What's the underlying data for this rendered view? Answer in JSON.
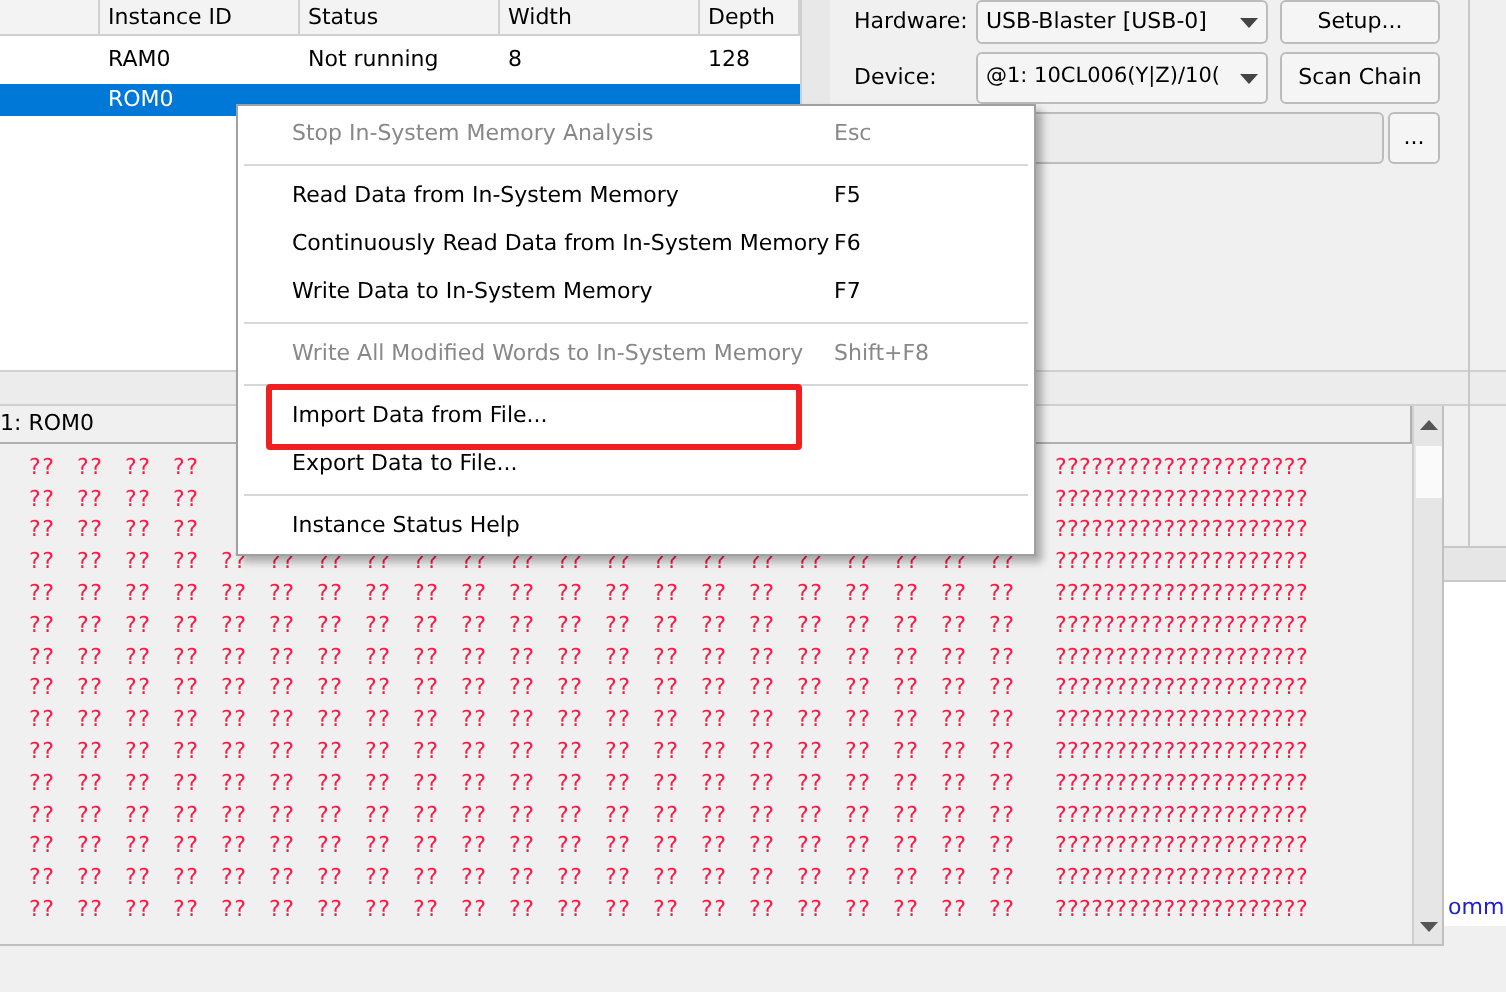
{
  "instances": {
    "columns": [
      "Instance ID",
      "Status",
      "Width",
      "Depth"
    ],
    "rows": [
      {
        "cells": [
          "RAM0",
          "Not running",
          "8",
          "128"
        ],
        "selected": false
      },
      {
        "cells": [
          "ROM0"
        ],
        "selected": true
      }
    ]
  },
  "jtag": {
    "hardware_label": "Hardware:",
    "hardware": "USB-Blaster [USB-0]",
    "setup_button": "Setup...",
    "device_label": "Device:",
    "device": "@1: 10CL006(Y|Z)/10(",
    "scan_button": "Scan Chain",
    "browse_button": "..."
  },
  "memory": {
    "title": "1: ROM0",
    "rows": [
      {
        "cells": [
          "??",
          "??",
          "??",
          "??"
        ],
        "ascii": "?????????????????????"
      },
      {
        "cells": [
          "??",
          "??",
          "??",
          "??"
        ],
        "ascii": "?????????????????????"
      },
      {
        "cells": [
          "??",
          "??",
          "??",
          "??"
        ],
        "ascii": "?????????????????????"
      },
      {
        "cells": [
          "??",
          "??",
          "??",
          "??",
          "??",
          "??",
          "??",
          "??",
          "??",
          "??",
          "??",
          "??",
          "??",
          "??",
          "??",
          "??",
          "??",
          "??",
          "??",
          "??",
          "??"
        ],
        "ascii": "?????????????????????"
      },
      {
        "cells": [
          "??",
          "??",
          "??",
          "??",
          "??",
          "??",
          "??",
          "??",
          "??",
          "??",
          "??",
          "??",
          "??",
          "??",
          "??",
          "??",
          "??",
          "??",
          "??",
          "??",
          "??"
        ],
        "ascii": "?????????????????????"
      },
      {
        "cells": [
          "??",
          "??",
          "??",
          "??",
          "??",
          "??",
          "??",
          "??",
          "??",
          "??",
          "??",
          "??",
          "??",
          "??",
          "??",
          "??",
          "??",
          "??",
          "??",
          "??",
          "??"
        ],
        "ascii": "?????????????????????"
      },
      {
        "cells": [
          "??",
          "??",
          "??",
          "??",
          "??",
          "??",
          "??",
          "??",
          "??",
          "??",
          "??",
          "??",
          "??",
          "??",
          "??",
          "??",
          "??",
          "??",
          "??",
          "??",
          "??"
        ],
        "ascii": "?????????????????????"
      },
      {
        "cells": [
          "??",
          "??",
          "??",
          "??",
          "??",
          "??",
          "??",
          "??",
          "??",
          "??",
          "??",
          "??",
          "??",
          "??",
          "??",
          "??",
          "??",
          "??",
          "??",
          "??",
          "??"
        ],
        "ascii": "?????????????????????"
      },
      {
        "cells": [
          "??",
          "??",
          "??",
          "??",
          "??",
          "??",
          "??",
          "??",
          "??",
          "??",
          "??",
          "??",
          "??",
          "??",
          "??",
          "??",
          "??",
          "??",
          "??",
          "??",
          "??"
        ],
        "ascii": "?????????????????????"
      },
      {
        "cells": [
          "??",
          "??",
          "??",
          "??",
          "??",
          "??",
          "??",
          "??",
          "??",
          "??",
          "??",
          "??",
          "??",
          "??",
          "??",
          "??",
          "??",
          "??",
          "??",
          "??",
          "??"
        ],
        "ascii": "?????????????????????"
      },
      {
        "cells": [
          "??",
          "??",
          "??",
          "??",
          "??",
          "??",
          "??",
          "??",
          "??",
          "??",
          "??",
          "??",
          "??",
          "??",
          "??",
          "??",
          "??",
          "??",
          "??",
          "??",
          "??"
        ],
        "ascii": "?????????????????????"
      },
      {
        "cells": [
          "??",
          "??",
          "??",
          "??",
          "??",
          "??",
          "??",
          "??",
          "??",
          "??",
          "??",
          "??",
          "??",
          "??",
          "??",
          "??",
          "??",
          "??",
          "??",
          "??",
          "??"
        ],
        "ascii": "?????????????????????"
      },
      {
        "cells": [
          "??",
          "??",
          "??",
          "??",
          "??",
          "??",
          "??",
          "??",
          "??",
          "??",
          "??",
          "??",
          "??",
          "??",
          "??",
          "??",
          "??",
          "??",
          "??",
          "??",
          "??"
        ],
        "ascii": "?????????????????????"
      },
      {
        "cells": [
          "??",
          "??",
          "??",
          "??",
          "??",
          "??",
          "??",
          "??",
          "??",
          "??",
          "??",
          "??",
          "??",
          "??",
          "??",
          "??",
          "??",
          "??",
          "??",
          "??",
          "??"
        ],
        "ascii": "?????????????????????"
      },
      {
        "cells": [
          "??",
          "??",
          "??",
          "??",
          "??",
          "??",
          "??",
          "??",
          "??",
          "??",
          "??",
          "??",
          "??",
          "??",
          "??",
          "??",
          "??",
          "??",
          "??",
          "??",
          "??"
        ],
        "ascii": "?????????????????????"
      }
    ]
  },
  "side_text": "omm",
  "context_menu": [
    {
      "kind": "item",
      "label": "Stop In-System Memory Analysis",
      "shortcut": "Esc",
      "disabled": true,
      "annotated": false
    },
    {
      "kind": "separator"
    },
    {
      "kind": "item",
      "label": "Read Data from In-System Memory",
      "shortcut": "F5",
      "disabled": false,
      "annotated": false
    },
    {
      "kind": "item",
      "label": "Continuously Read Data from In-System Memory",
      "shortcut": "F6",
      "disabled": false,
      "annotated": false
    },
    {
      "kind": "item",
      "label": "Write Data to In-System Memory",
      "shortcut": "F7",
      "disabled": false,
      "annotated": false
    },
    {
      "kind": "separator"
    },
    {
      "kind": "item",
      "label": "Write All Modified Words to In-System Memory",
      "shortcut": "Shift+F8",
      "disabled": true,
      "annotated": false
    },
    {
      "kind": "separator"
    },
    {
      "kind": "item",
      "label": "Import Data from File...",
      "disabled": false,
      "annotated": true
    },
    {
      "kind": "item",
      "label": "Export Data to File...",
      "disabled": false,
      "annotated": false
    },
    {
      "kind": "separator"
    },
    {
      "kind": "item",
      "label": "Instance Status Help",
      "disabled": false,
      "annotated": false
    }
  ]
}
